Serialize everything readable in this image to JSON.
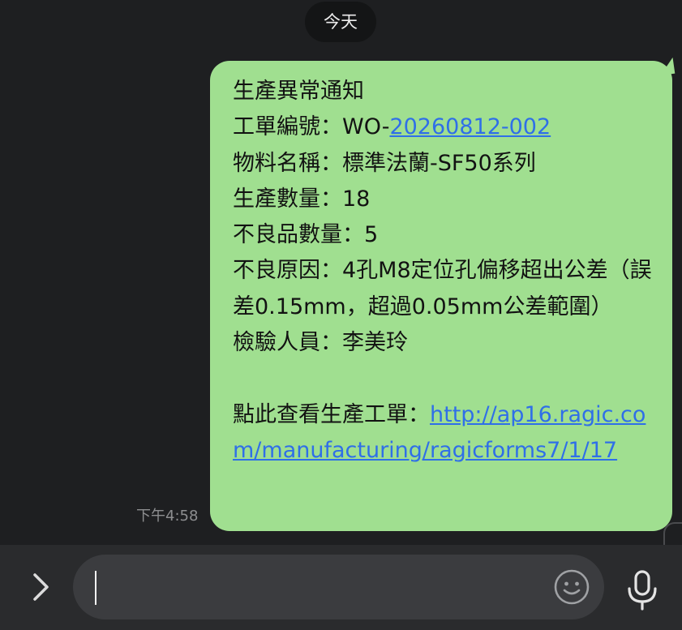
{
  "date_divider": "今天",
  "message": {
    "lines": {
      "title": "生產異常通知",
      "work_order_label": "工單編號：WO-",
      "work_order_number": "20260812-002",
      "material": "物料名稱：標準法蘭-SF50系列",
      "quantity": "生產數量：18",
      "defect_quantity": "不良品數量：5",
      "defect_reason": "不良原因：4孔M8定位孔偏移超出公差（誤差0.15mm，超過0.05mm公差範圍）",
      "inspector": "檢驗人員：李美玲",
      "view_prompt": "點此查看生產工單：",
      "view_link": "http://ap16.ragic.com/manufacturing/ragicforms7/1/17"
    },
    "time": "下午4:58"
  },
  "colors": {
    "background": "#1e1f21",
    "bubble": "#a0df90",
    "link": "#2f6fe8"
  },
  "input_bar": {
    "text": "",
    "icons": [
      "chevron-right-icon",
      "emoji-icon",
      "microphone-icon"
    ]
  }
}
